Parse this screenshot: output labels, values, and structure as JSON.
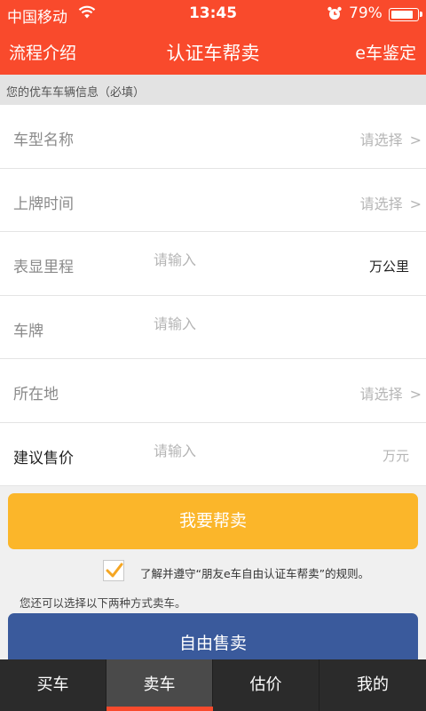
{
  "status_bar": {
    "carrier": "中国移动",
    "time": "13:45",
    "battery": "79%",
    "battery_level": 0.79,
    "icons": [
      "wifi-icon",
      "alarm-icon",
      "battery-icon"
    ]
  },
  "nav": {
    "left": "流程介绍",
    "title": "认证车帮卖",
    "right": "e车鉴定"
  },
  "section_header": "您的优车车辆信息（必填）",
  "form": {
    "rows": [
      {
        "label": "车型名称",
        "hint": "请选择",
        "chevron": ">"
      },
      {
        "label": "上牌时间",
        "hint": "请选择",
        "chevron": ">"
      },
      {
        "label": "表显里程",
        "placeholder": "请输入",
        "unit": "万公里"
      },
      {
        "label": "车牌",
        "placeholder": "请输入"
      },
      {
        "label": "所在地",
        "hint": "请选择",
        "chevron": ">"
      },
      {
        "label": "建议售价",
        "placeholder": "请输入",
        "unit": "万元"
      }
    ]
  },
  "actions": {
    "help_sell": "我要帮卖",
    "agree_text": "了解并遵守“朋友e车自由认证车帮卖”的规则。",
    "agree_checked": true,
    "note": "您还可以选择以下两种方式卖车。",
    "free_sell": "自由售卖"
  },
  "tabbar": {
    "tabs": [
      {
        "label": "买车"
      },
      {
        "label": "卖车"
      },
      {
        "label": "估价"
      },
      {
        "label": "我的"
      }
    ],
    "active": "卖车"
  },
  "colors": {
    "brand_red": "#f94a2c",
    "help_button": "#fbb62a",
    "free_button": "#3a5a9c",
    "checkmark": "#f5a623",
    "tabbar_bg": "#2b2b2b"
  }
}
